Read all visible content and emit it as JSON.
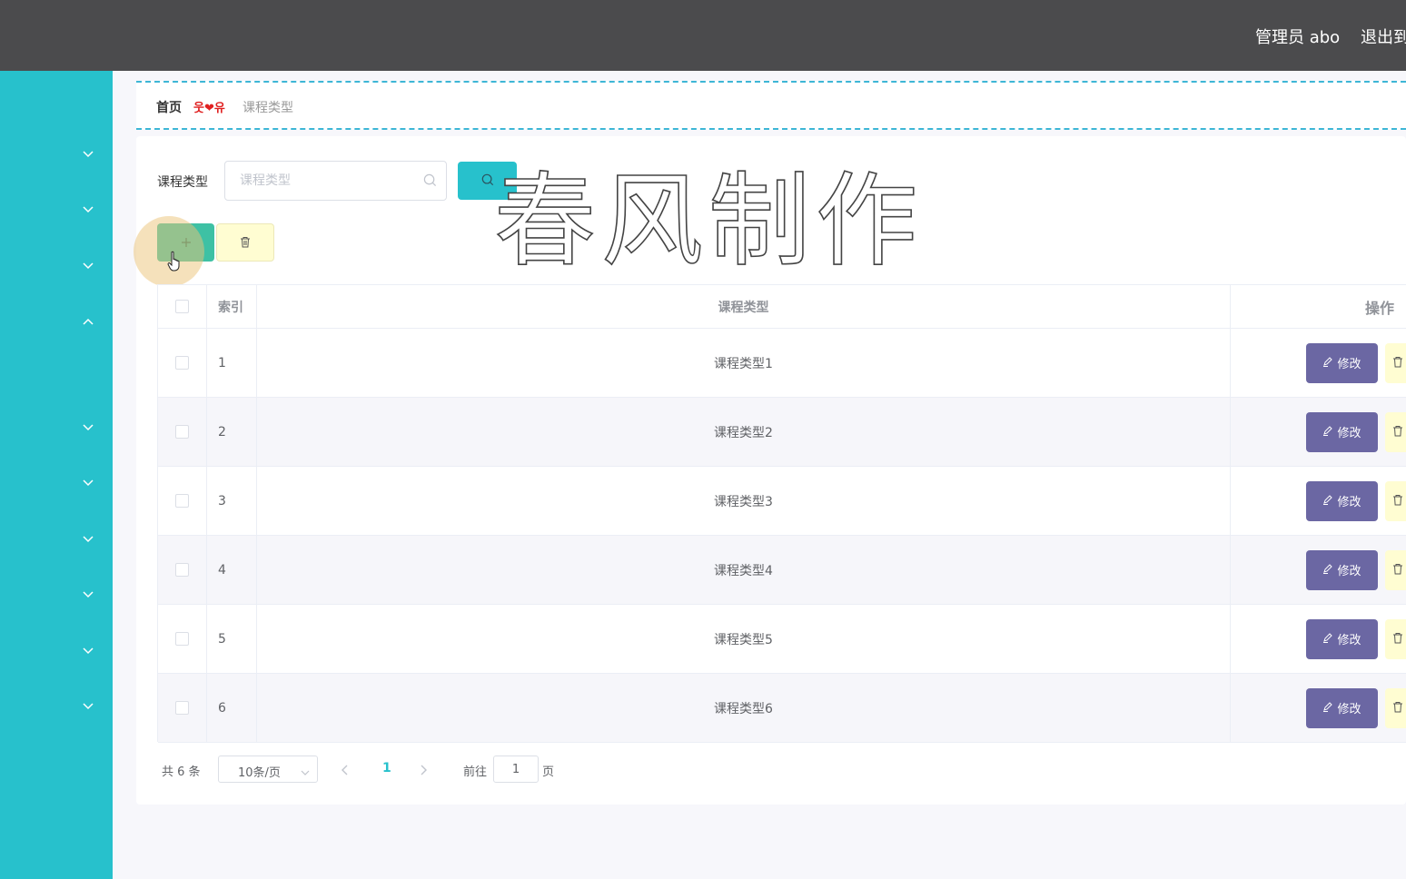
{
  "header": {
    "user_label": "管理员 abo",
    "logout_label": "退出到前台"
  },
  "colors": {
    "sidebar": "#27c1cc",
    "topbar": "#4b4b4d",
    "add_button": "#3ec1a4",
    "edit_button": "#6b67a3",
    "delete_button": "#fffdd2",
    "accent": "#27c1cc"
  },
  "sidebar": {
    "items": [
      {
        "icon": "chevron-down-icon"
      },
      {
        "icon": "chevron-down-icon"
      },
      {
        "icon": "chevron-down-icon"
      },
      {
        "icon": "chevron-up-icon"
      },
      {
        "icon": "chevron-down-icon"
      },
      {
        "icon": "chevron-down-icon"
      },
      {
        "icon": "chevron-down-icon"
      },
      {
        "icon": "chevron-down-icon"
      },
      {
        "icon": "chevron-down-icon"
      },
      {
        "icon": "chevron-down-icon"
      }
    ]
  },
  "breadcrumb": {
    "home": "首页",
    "separator": "웃❤유",
    "current": "课程类型"
  },
  "search": {
    "label": "课程类型",
    "placeholder": "课程类型",
    "value": ""
  },
  "watermark": "春风制作",
  "table": {
    "headers": {
      "index": "索引",
      "name": "课程类型",
      "actions": "操作"
    },
    "edit_label": "修改",
    "rows": [
      {
        "index": "1",
        "name": "课程类型1"
      },
      {
        "index": "2",
        "name": "课程类型2"
      },
      {
        "index": "3",
        "name": "课程类型3"
      },
      {
        "index": "4",
        "name": "课程类型4"
      },
      {
        "index": "5",
        "name": "课程类型5"
      },
      {
        "index": "6",
        "name": "课程类型6"
      }
    ]
  },
  "pagination": {
    "total": "共 6 条",
    "page_size": "10条/页",
    "current_page": "1",
    "goto_label": "前往",
    "goto_value": "1",
    "page_unit": "页"
  }
}
